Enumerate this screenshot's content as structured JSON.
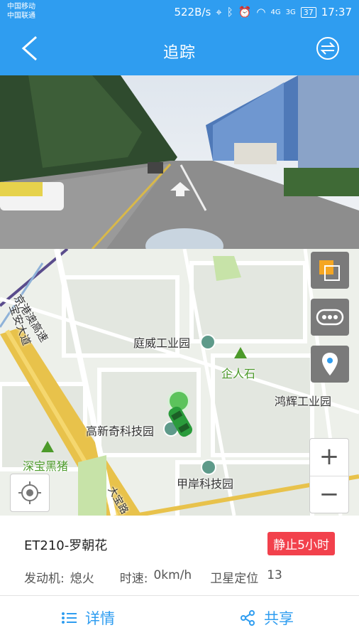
{
  "status": {
    "carrier1": "中国移动",
    "carrier2": "中国联通",
    "speed": "522B/s",
    "net1": "4G",
    "net2": "3G",
    "battery": "37",
    "time": "17:37"
  },
  "nav": {
    "title": "追踪"
  },
  "map": {
    "labels": {
      "tingwei": "庭威工业园",
      "qierenshi": "企人石",
      "honghui": "鸿辉工业园",
      "gaoxinqi": "高新奇科技园",
      "shenbao": "深宝黑猪",
      "jiaan": "甲岸科技园",
      "road_hk": "京港澳高速",
      "road_wei": "宝安大道",
      "road_jd": "大宝路"
    }
  },
  "vehicle": {
    "name": "ET210-罗朝花",
    "status_badge": "静止5小时",
    "engine_label": "发动机:",
    "engine_value": "熄火",
    "speed_label": "时速:",
    "speed_value": "0km/h",
    "gps_label": "卫星定位",
    "gps_value": "13"
  },
  "actions": {
    "details": "详情",
    "share": "共享"
  }
}
